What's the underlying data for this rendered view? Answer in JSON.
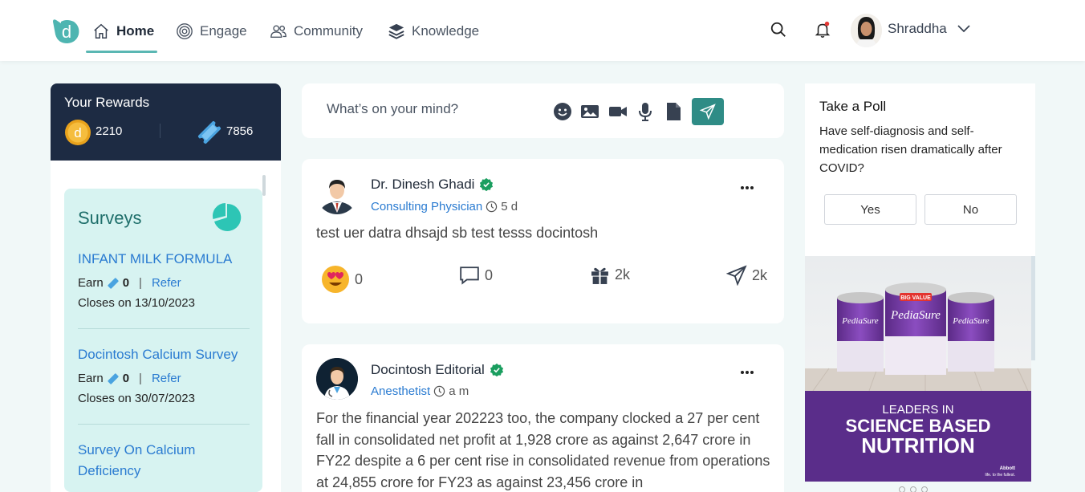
{
  "nav": {
    "items": [
      {
        "label": "Home",
        "icon": "home-icon"
      },
      {
        "label": "Engage",
        "icon": "target-icon"
      },
      {
        "label": "Community",
        "icon": "people-icon"
      },
      {
        "label": "Knowledge",
        "icon": "layers-icon"
      }
    ],
    "user_name": "Shraddha",
    "accent": "#5ab7b3"
  },
  "rewards": {
    "title": "Your Rewards",
    "coins": "2210",
    "tickets": "7856"
  },
  "surveys": {
    "title": "Surveys",
    "items": [
      {
        "name": "INFANT MILK FORMULA",
        "earn_label": "Earn",
        "earn_value": "0",
        "refer": "Refer",
        "closes": "Closes on 13/10/2023"
      },
      {
        "name": "Docintosh Calcium Survey",
        "earn_label": "Earn",
        "earn_value": "0",
        "refer": "Refer",
        "closes": "Closes on 30/07/2023"
      },
      {
        "name": "Survey On Calcium Deficiency"
      }
    ]
  },
  "composer": {
    "placeholder": "What’s on your mind?"
  },
  "posts": [
    {
      "author": "Dr. Dinesh Ghadi",
      "role": "Consulting Physician",
      "time": "5 d",
      "text": "test uer datra dhsajd sb test tesss docintosh",
      "reactions": "0",
      "comments": "0",
      "gifts": "2k",
      "shares": "2k"
    },
    {
      "author": "Docintosh Editorial",
      "role": "Anesthetist",
      "time": "a m",
      "text": "For the financial year 202223 too, the company clocked a 27 per cent fall in consolidated net profit at 1,928 crore as against 2,647 crore in FY22 despite a 6 per cent rise in consolidated revenue from operations at 24,855 crore for FY23 as against 23,456 crore in"
    }
  ],
  "poll": {
    "title": "Take a Poll",
    "question": "Have self-diagnosis and self-medication risen dramatically after COVID?",
    "options": [
      "Yes",
      "No"
    ]
  },
  "ad": {
    "brand": "PediaSure",
    "badge": "BIG VALUE",
    "line1": "LEADERS IN",
    "line2": "SCIENCE BASED",
    "line3": "NUTRITION",
    "sponsor": "Abbott",
    "tagline": "life. to the fullest."
  }
}
